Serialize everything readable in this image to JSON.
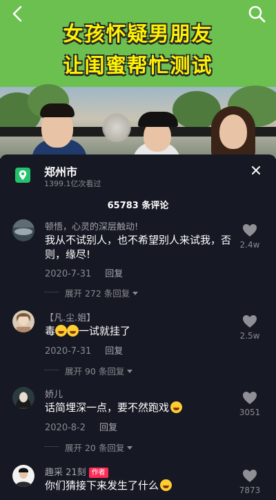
{
  "video": {
    "title_line1": "女孩怀疑男朋友",
    "title_line2": "让闺蜜帮忙测试"
  },
  "panel": {
    "location_name": "郑州市",
    "location_views": "1399.1亿次看过",
    "comment_count": "65783 条评论"
  },
  "comments": [
    {
      "username": "顿悟，心灵的深层触动!",
      "text": "我从不试别人，也不希望别人来试我，否则，缘尽!",
      "date": "2020-7-31",
      "reply_label": "回复",
      "likes": "2.4w",
      "expand_label": "展开 272 条回复"
    },
    {
      "username": "【凡.尘.姐】",
      "text_before": "毒",
      "text_after": "一试就挂了",
      "date": "2020-7-31",
      "reply_label": "回复",
      "likes": "2.5w",
      "expand_label": "展开 90 条回复"
    },
    {
      "username": "娇儿",
      "text": "话简埋深一点，要不然跑戏",
      "date": "2020-8-2",
      "reply_label": "回复",
      "likes": "3051",
      "expand_label": "展开 20 条回复"
    },
    {
      "username": "趣采 21刻",
      "author_badge": "作者",
      "text": "你们猜接下来发生了什么",
      "likes": "7873"
    }
  ],
  "colors": {
    "panel_bg": "#161823",
    "banner_green": "#6cc04f",
    "title_yellow": "#fff200",
    "location_icon": "#25c26e",
    "author_badge": "#fe2c55"
  }
}
